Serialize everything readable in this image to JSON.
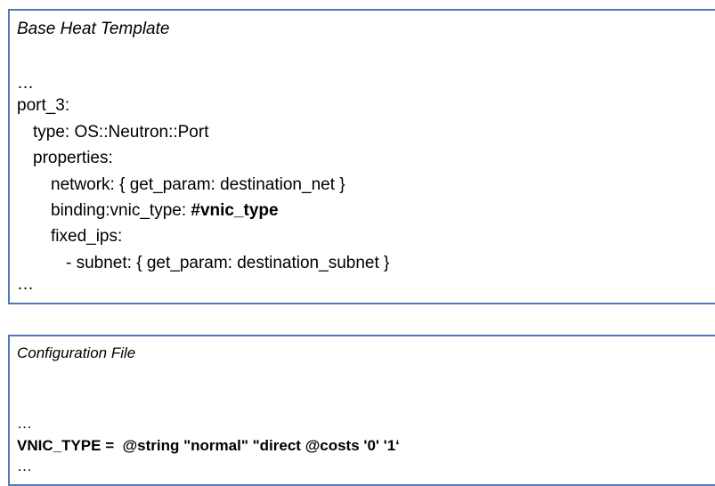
{
  "template_box": {
    "title": "Base Heat Template",
    "lines": [
      "…",
      "port_3:",
      "type: OS::Neutron::Port",
      "properties:",
      "network: { get_param: destination_net }",
      "binding:vnic_type: ",
      "#vnic_type",
      "fixed_ips:",
      "- subnet: { get_param: destination_subnet }",
      "…"
    ]
  },
  "config_box": {
    "title": "Configuration File",
    "lines": [
      "…",
      "VNIC_TYPE =  @string \"normal\" \"direct @costs '0' '1‘",
      "…"
    ]
  },
  "colors": {
    "border": "#4f7bb4",
    "text": "#000000",
    "background": "#ffffff"
  }
}
